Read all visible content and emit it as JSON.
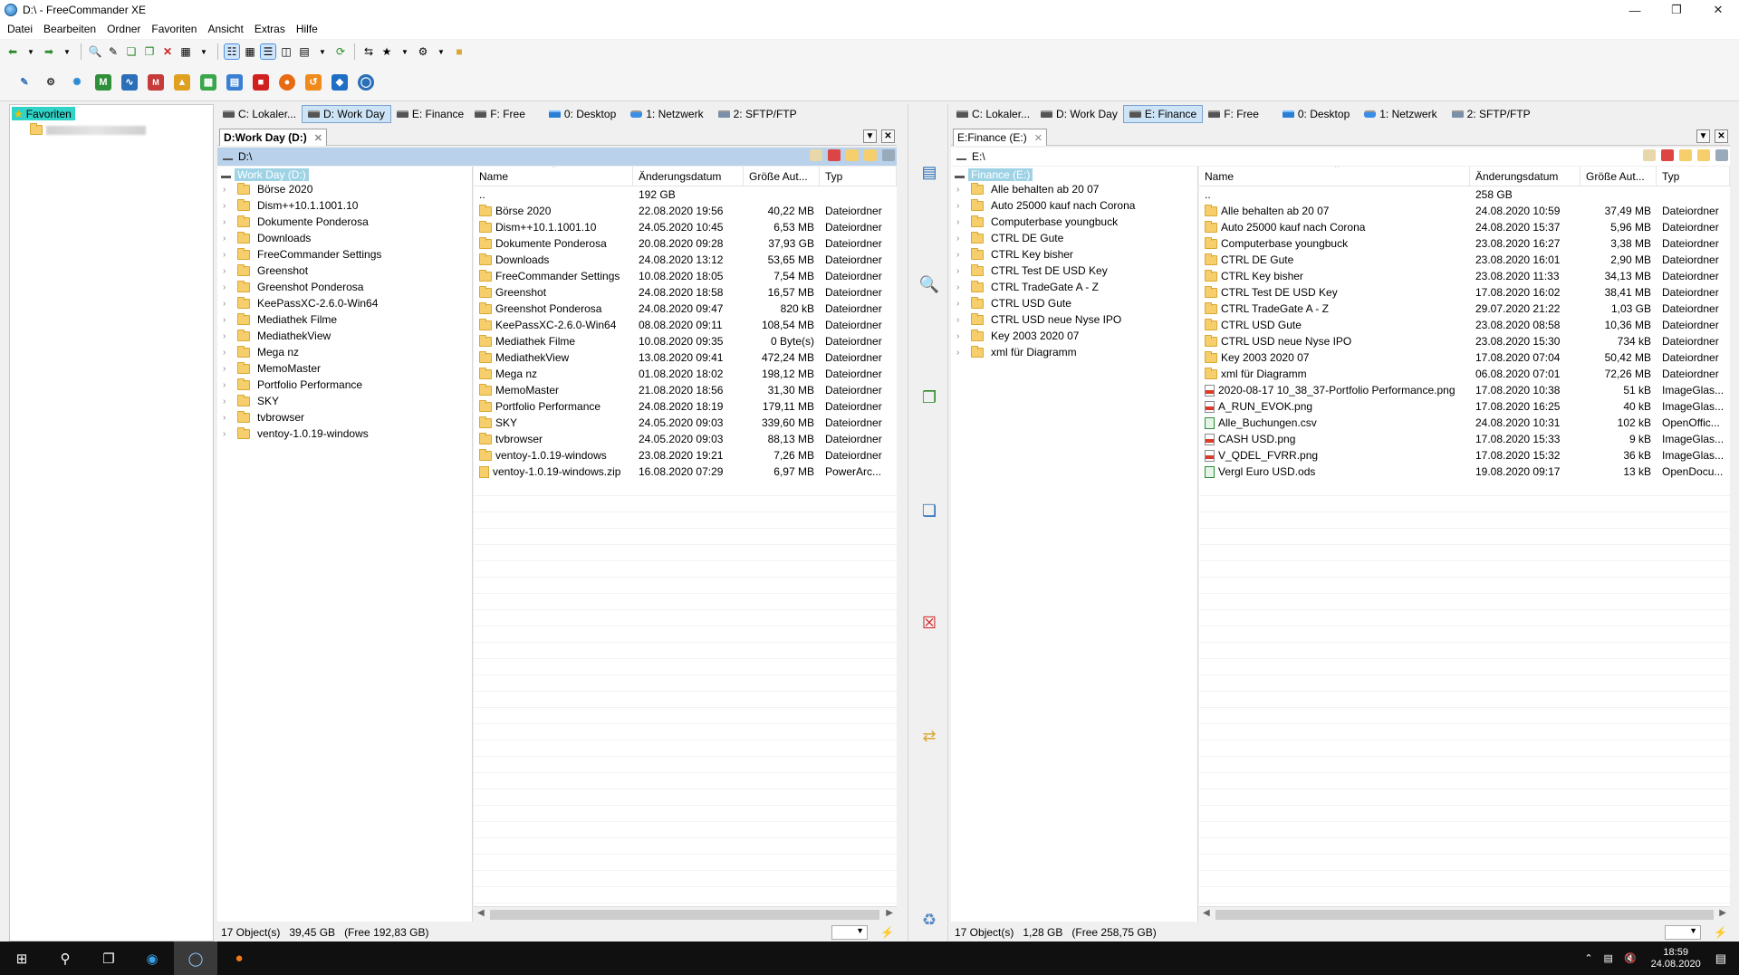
{
  "window": {
    "title": "D:\\ - FreeCommander XE"
  },
  "menu": [
    "Datei",
    "Bearbeiten",
    "Ordner",
    "Favoriten",
    "Ansicht",
    "Extras",
    "Hilfe"
  ],
  "favorites": {
    "root_label": "Favoriten"
  },
  "colors": {
    "selected_tab": "#cde4f7",
    "pathbar": "#b9d1ea",
    "folder": "#f6cf6c",
    "favorites_highlight": "#2fd3c7"
  },
  "left": {
    "drive_tabs": [
      "C: Lokaler...",
      "D: Work Day",
      "E: Finance",
      "F: Free",
      "0: Desktop",
      "1: Netzwerk",
      "2: SFTP/FTP"
    ],
    "active_drive_tab": 1,
    "path_tab": "D:Work Day (D:)",
    "path": "D:\\",
    "tree_root": "Work Day (D:)",
    "tree": [
      "Börse 2020",
      "Dism++10.1.1001.10",
      "Dokumente Ponderosa",
      "Downloads",
      "FreeCommander Settings",
      "Greenshot",
      "Greenshot Ponderosa",
      "KeePassXC-2.6.0-Win64",
      "Mediathek Filme",
      "MediathekView",
      "Mega nz",
      "MemoMaster",
      "Portfolio Performance",
      "SKY",
      "tvbrowser",
      "ventoy-1.0.19-windows"
    ],
    "columns": [
      "Name",
      "Änderungsdatum",
      "Größe Aut...",
      "Typ"
    ],
    "up_row": {
      "name": "..",
      "size": "192 GB"
    },
    "files": [
      {
        "name": "Börse 2020",
        "date": "22.08.2020 19:56",
        "size": "40,22 MB",
        "type": "Dateiordner",
        "icon": "folder"
      },
      {
        "name": "Dism++10.1.1001.10",
        "date": "24.05.2020 10:45",
        "size": "6,53 MB",
        "type": "Dateiordner",
        "icon": "folder"
      },
      {
        "name": "Dokumente Ponderosa",
        "date": "20.08.2020 09:28",
        "size": "37,93 GB",
        "type": "Dateiordner",
        "icon": "folder"
      },
      {
        "name": "Downloads",
        "date": "24.08.2020 13:12",
        "size": "53,65 MB",
        "type": "Dateiordner",
        "icon": "folder"
      },
      {
        "name": "FreeCommander Settings",
        "date": "10.08.2020 18:05",
        "size": "7,54 MB",
        "type": "Dateiordner",
        "icon": "folder"
      },
      {
        "name": "Greenshot",
        "date": "24.08.2020 18:58",
        "size": "16,57 MB",
        "type": "Dateiordner",
        "icon": "folder"
      },
      {
        "name": "Greenshot Ponderosa",
        "date": "24.08.2020 09:47",
        "size": "820 kB",
        "type": "Dateiordner",
        "icon": "folder"
      },
      {
        "name": "KeePassXC-2.6.0-Win64",
        "date": "08.08.2020 09:11",
        "size": "108,54 MB",
        "type": "Dateiordner",
        "icon": "folder"
      },
      {
        "name": "Mediathek Filme",
        "date": "10.08.2020 09:35",
        "size": "0 Byte(s)",
        "type": "Dateiordner",
        "icon": "folder"
      },
      {
        "name": "MediathekView",
        "date": "13.08.2020 09:41",
        "size": "472,24 MB",
        "type": "Dateiordner",
        "icon": "folder"
      },
      {
        "name": "Mega nz",
        "date": "01.08.2020 18:02",
        "size": "198,12 MB",
        "type": "Dateiordner",
        "icon": "folder"
      },
      {
        "name": "MemoMaster",
        "date": "21.08.2020 18:56",
        "size": "31,30 MB",
        "type": "Dateiordner",
        "icon": "folder"
      },
      {
        "name": "Portfolio Performance",
        "date": "24.08.2020 18:19",
        "size": "179,11 MB",
        "type": "Dateiordner",
        "icon": "folder"
      },
      {
        "name": "SKY",
        "date": "24.05.2020 09:03",
        "size": "339,60 MB",
        "type": "Dateiordner",
        "icon": "folder"
      },
      {
        "name": "tvbrowser",
        "date": "24.05.2020 09:03",
        "size": "88,13 MB",
        "type": "Dateiordner",
        "icon": "folder"
      },
      {
        "name": "ventoy-1.0.19-windows",
        "date": "23.08.2020 19:21",
        "size": "7,26 MB",
        "type": "Dateiordner",
        "icon": "folder"
      },
      {
        "name": "ventoy-1.0.19-windows.zip",
        "date": "16.08.2020 07:29",
        "size": "6,97 MB",
        "type": "PowerArc...",
        "icon": "zip"
      }
    ],
    "status": {
      "objects": "17 Object(s)",
      "size": "39,45 GB",
      "free": "(Free 192,83 GB)"
    }
  },
  "right": {
    "drive_tabs": [
      "C: Lokaler...",
      "D: Work Day",
      "E: Finance",
      "F: Free",
      "0: Desktop",
      "1: Netzwerk",
      "2: SFTP/FTP"
    ],
    "active_drive_tab": 2,
    "path_tab": "E:Finance (E:)",
    "path": "E:\\",
    "tree_root": "Finance (E:)",
    "tree": [
      "Alle behalten ab 20 07",
      "Auto 25000 kauf nach Corona",
      "Computerbase youngbuck",
      "CTRL DE Gute",
      "CTRL Key bisher",
      "CTRL Test DE USD Key",
      "CTRL TradeGate A - Z",
      "CTRL USD Gute",
      "CTRL USD neue Nyse IPO",
      "Key 2003 2020 07",
      "xml für Diagramm"
    ],
    "columns": [
      "Name",
      "Änderungsdatum",
      "Größe Aut...",
      "Typ"
    ],
    "up_row": {
      "name": "..",
      "size": "258 GB"
    },
    "files": [
      {
        "name": "Alle behalten ab 20 07",
        "date": "24.08.2020 10:59",
        "size": "37,49 MB",
        "type": "Dateiordner",
        "icon": "folder"
      },
      {
        "name": "Auto 25000 kauf nach Corona",
        "date": "24.08.2020 15:37",
        "size": "5,96 MB",
        "type": "Dateiordner",
        "icon": "folder"
      },
      {
        "name": "Computerbase youngbuck",
        "date": "23.08.2020 16:27",
        "size": "3,38 MB",
        "type": "Dateiordner",
        "icon": "folder"
      },
      {
        "name": "CTRL DE Gute",
        "date": "23.08.2020 16:01",
        "size": "2,90 MB",
        "type": "Dateiordner",
        "icon": "folder"
      },
      {
        "name": "CTRL Key bisher",
        "date": "23.08.2020 11:33",
        "size": "34,13 MB",
        "type": "Dateiordner",
        "icon": "folder"
      },
      {
        "name": "CTRL Test DE USD Key",
        "date": "17.08.2020 16:02",
        "size": "38,41 MB",
        "type": "Dateiordner",
        "icon": "folder"
      },
      {
        "name": "CTRL TradeGate A - Z",
        "date": "29.07.2020 21:22",
        "size": "1,03 GB",
        "type": "Dateiordner",
        "icon": "folder"
      },
      {
        "name": "CTRL USD Gute",
        "date": "23.08.2020 08:58",
        "size": "10,36 MB",
        "type": "Dateiordner",
        "icon": "folder"
      },
      {
        "name": "CTRL USD neue Nyse IPO",
        "date": "23.08.2020 15:30",
        "size": "734 kB",
        "type": "Dateiordner",
        "icon": "folder"
      },
      {
        "name": "Key 2003 2020 07",
        "date": "17.08.2020 07:04",
        "size": "50,42 MB",
        "type": "Dateiordner",
        "icon": "folder"
      },
      {
        "name": "xml für Diagramm",
        "date": "06.08.2020 07:01",
        "size": "72,26 MB",
        "type": "Dateiordner",
        "icon": "folder"
      },
      {
        "name": "2020-08-17 10_38_37-Portfolio Performance.png",
        "date": "17.08.2020 10:38",
        "size": "51 kB",
        "type": "ImageGlas...",
        "icon": "png"
      },
      {
        "name": "A_RUN_EVOK.png",
        "date": "17.08.2020 16:25",
        "size": "40 kB",
        "type": "ImageGlas...",
        "icon": "png"
      },
      {
        "name": "Alle_Buchungen.csv",
        "date": "24.08.2020 10:31",
        "size": "102 kB",
        "type": "OpenOffic...",
        "icon": "csv"
      },
      {
        "name": "CASH USD.png",
        "date": "17.08.2020 15:33",
        "size": "9 kB",
        "type": "ImageGlas...",
        "icon": "png"
      },
      {
        "name": "V_QDEL_FVRR.png",
        "date": "17.08.2020 15:32",
        "size": "36 kB",
        "type": "ImageGlas...",
        "icon": "png"
      },
      {
        "name": "Vergl Euro USD.ods",
        "date": "19.08.2020 09:17",
        "size": "13 kB",
        "type": "OpenDocu...",
        "icon": "ods"
      }
    ],
    "status": {
      "objects": "17 Object(s)",
      "size": "1,28 GB",
      "free": "(Free 258,75 GB)"
    }
  },
  "taskbar": {
    "time": "18:59",
    "date": "24.08.2020"
  }
}
